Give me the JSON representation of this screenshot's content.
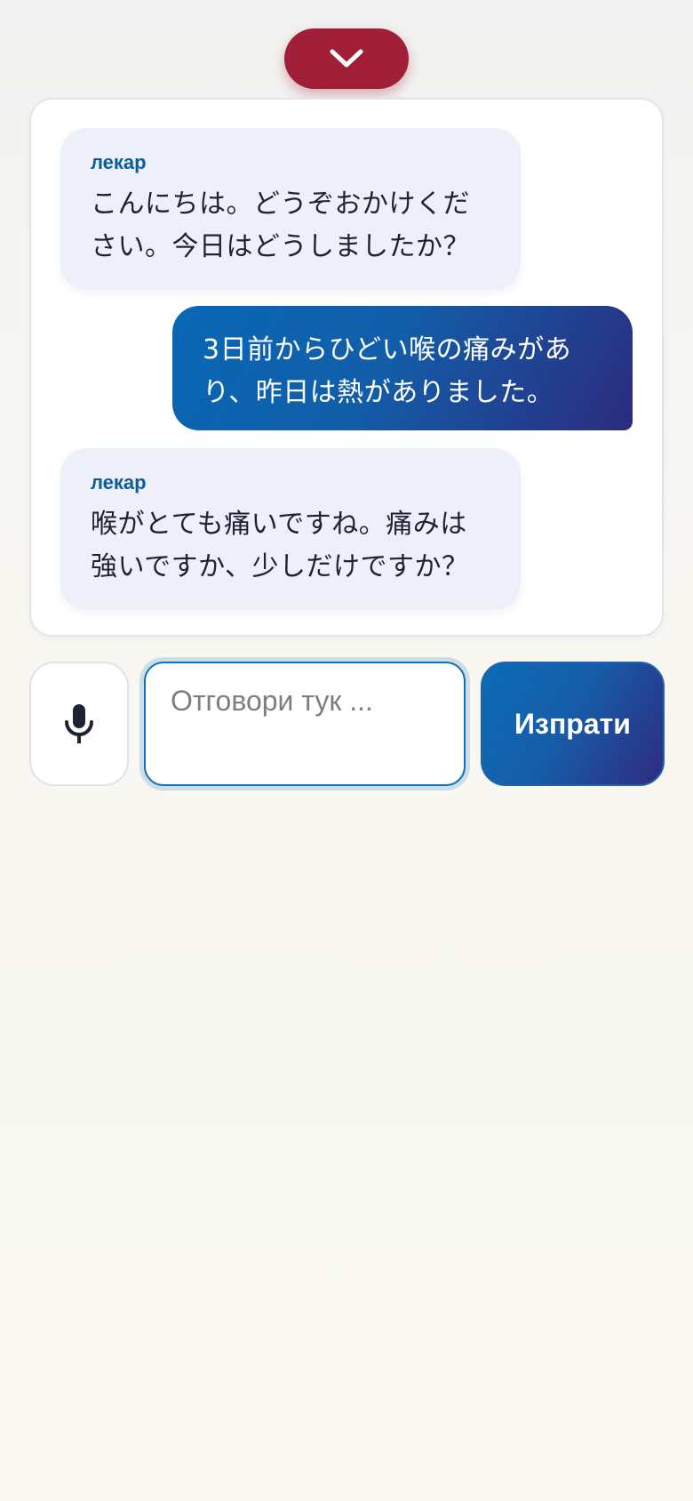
{
  "header": {
    "collapse_icon": "chevron-down-icon",
    "collapse_color": "#a01f36"
  },
  "chat": {
    "messages": [
      {
        "role": "bot",
        "sender": "лекар",
        "text": "こんにちは。どうぞおかけください。今日はどうしましたか？"
      },
      {
        "role": "user",
        "text": "3日前からひどい喉の痛みがあり、昨日は熱がありました。"
      },
      {
        "role": "bot",
        "sender": "лекар",
        "text": "喉がとても痛いですね。痛みは強いですか、少しだけですか？"
      }
    ]
  },
  "composer": {
    "mic_icon": "microphone-icon",
    "input_value": "",
    "input_placeholder": "Отговори тук ...",
    "send_label": "Изпрати",
    "accent_color": "#0b6bb6"
  }
}
